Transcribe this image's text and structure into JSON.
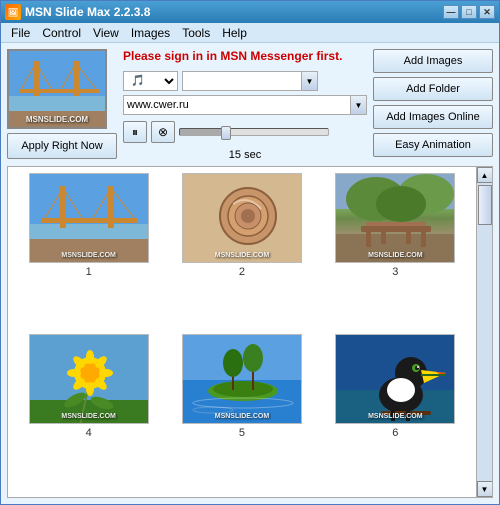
{
  "window": {
    "title": "MSN Slide Max  2.2.3.8",
    "icon": "🖼"
  },
  "titleControls": {
    "minimize": "—",
    "maximize": "□",
    "close": "✕"
  },
  "menu": {
    "items": [
      "File",
      "Control",
      "View",
      "Images",
      "Tools",
      "Help"
    ]
  },
  "preview": {
    "label": "MSNSLIDE.COM"
  },
  "signIn": {
    "text": "Please sign in in MSN Messenger first."
  },
  "dropdowns": {
    "icon": "▼",
    "urlValue": "www.cwer.ru"
  },
  "buttons": {
    "addImages": "Add Images",
    "addFolder": "Add Folder",
    "addImagesOnline": "Add Images Online",
    "easyAnimation": "Easy Animation",
    "applyRightNow": "Apply Right Now"
  },
  "playback": {
    "pause": "⏸",
    "stop": "⊗",
    "sliderTicks": "· · · · · · · · · · · · · ·",
    "duration": "15 sec"
  },
  "images": [
    {
      "number": "1",
      "type": "bridge",
      "label": "MSNSLIDE.COM"
    },
    {
      "number": "2",
      "type": "snail",
      "label": "MSNSLIDE.COM"
    },
    {
      "number": "3",
      "type": "bench",
      "label": "MSNSLIDE.COM"
    },
    {
      "number": "4",
      "type": "dandelion",
      "label": "MSNSLIDE.COM"
    },
    {
      "number": "5",
      "type": "island",
      "label": "MSNSLIDE.COM"
    },
    {
      "number": "6",
      "type": "toucan",
      "label": "MSNSLIDE.COM"
    }
  ]
}
